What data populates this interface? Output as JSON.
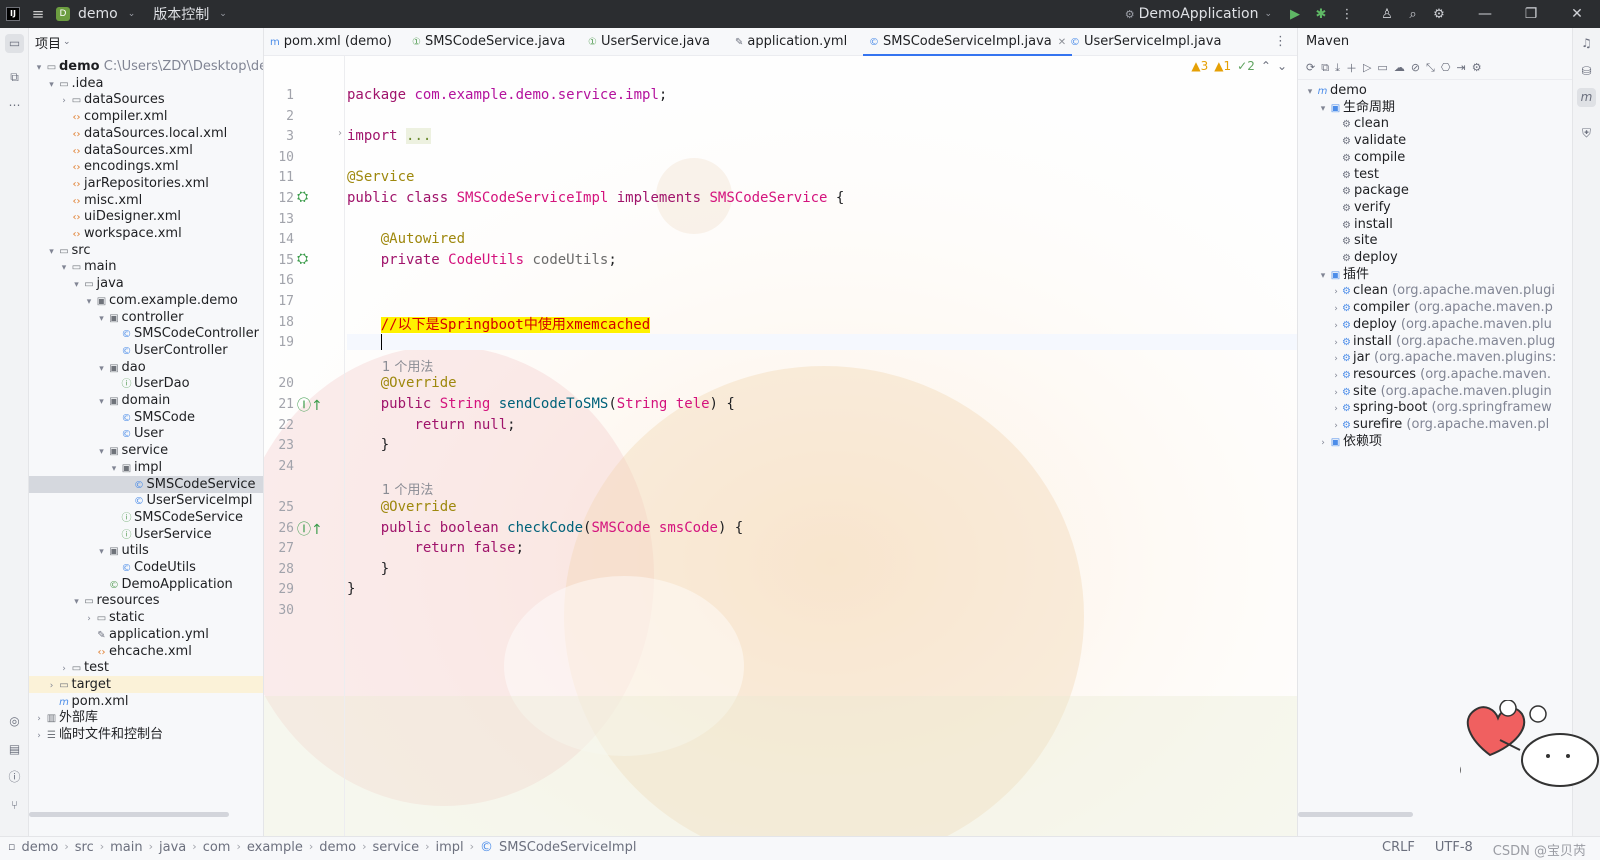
{
  "titlebar": {
    "project": "demo",
    "vcs": "版本控制",
    "run_config": "DemoApplication"
  },
  "project_panel": {
    "title": "项目",
    "tree": [
      {
        "label": "demo",
        "extra": "C:\\Users\\ZDY\\Desktop\\de",
        "depth": 0,
        "kind": "folder",
        "arrow": "▾",
        "bold": true
      },
      {
        "label": ".idea",
        "depth": 1,
        "kind": "folder",
        "arrow": "▾"
      },
      {
        "label": "dataSources",
        "depth": 2,
        "kind": "folder",
        "arrow": "›"
      },
      {
        "label": "compiler.xml",
        "depth": 2,
        "kind": "xml",
        "arrow": ""
      },
      {
        "label": "dataSources.local.xml",
        "depth": 2,
        "kind": "xml",
        "arrow": ""
      },
      {
        "label": "dataSources.xml",
        "depth": 2,
        "kind": "xml",
        "arrow": ""
      },
      {
        "label": "encodings.xml",
        "depth": 2,
        "kind": "xml",
        "arrow": ""
      },
      {
        "label": "jarRepositories.xml",
        "depth": 2,
        "kind": "xml",
        "arrow": ""
      },
      {
        "label": "misc.xml",
        "depth": 2,
        "kind": "xml",
        "arrow": ""
      },
      {
        "label": "uiDesigner.xml",
        "depth": 2,
        "kind": "xml",
        "arrow": ""
      },
      {
        "label": "workspace.xml",
        "depth": 2,
        "kind": "xml",
        "arrow": ""
      },
      {
        "label": "src",
        "depth": 1,
        "kind": "folder",
        "arrow": "▾"
      },
      {
        "label": "main",
        "depth": 2,
        "kind": "folder",
        "arrow": "▾"
      },
      {
        "label": "java",
        "depth": 3,
        "kind": "folder",
        "arrow": "▾"
      },
      {
        "label": "com.example.demo",
        "depth": 4,
        "kind": "pkg",
        "arrow": "▾"
      },
      {
        "label": "controller",
        "depth": 5,
        "kind": "pkg",
        "arrow": "▾"
      },
      {
        "label": "SMSCodeController",
        "depth": 6,
        "kind": "cls",
        "arrow": ""
      },
      {
        "label": "UserController",
        "depth": 6,
        "kind": "cls",
        "arrow": ""
      },
      {
        "label": "dao",
        "depth": 5,
        "kind": "pkg",
        "arrow": "▾"
      },
      {
        "label": "UserDao",
        "depth": 6,
        "kind": "intf",
        "arrow": ""
      },
      {
        "label": "domain",
        "depth": 5,
        "kind": "pkg",
        "arrow": "▾"
      },
      {
        "label": "SMSCode",
        "depth": 6,
        "kind": "cls",
        "arrow": ""
      },
      {
        "label": "User",
        "depth": 6,
        "kind": "cls",
        "arrow": ""
      },
      {
        "label": "service",
        "depth": 5,
        "kind": "pkg",
        "arrow": "▾"
      },
      {
        "label": "impl",
        "depth": 6,
        "kind": "pkg",
        "arrow": "▾"
      },
      {
        "label": "SMSCodeService",
        "depth": 7,
        "kind": "cls",
        "arrow": "",
        "selected": true
      },
      {
        "label": "UserServiceImpl",
        "depth": 7,
        "kind": "cls",
        "arrow": ""
      },
      {
        "label": "SMSCodeService",
        "depth": 6,
        "kind": "intf",
        "arrow": ""
      },
      {
        "label": "UserService",
        "depth": 6,
        "kind": "intf",
        "arrow": ""
      },
      {
        "label": "utils",
        "depth": 5,
        "kind": "pkg",
        "arrow": "▾"
      },
      {
        "label": "CodeUtils",
        "depth": 6,
        "kind": "cls",
        "arrow": ""
      },
      {
        "label": "DemoApplication",
        "depth": 5,
        "kind": "boot",
        "arrow": ""
      },
      {
        "label": "resources",
        "depth": 3,
        "kind": "folder",
        "arrow": "▾"
      },
      {
        "label": "static",
        "depth": 4,
        "kind": "folder",
        "arrow": "›"
      },
      {
        "label": "application.yml",
        "depth": 4,
        "kind": "yml",
        "arrow": ""
      },
      {
        "label": "ehcache.xml",
        "depth": 4,
        "kind": "xml",
        "arrow": ""
      },
      {
        "label": "test",
        "depth": 2,
        "kind": "folder",
        "arrow": "›"
      },
      {
        "label": "target",
        "depth": 1,
        "kind": "folder",
        "arrow": "›",
        "excluded": true
      },
      {
        "label": "pom.xml",
        "depth": 1,
        "kind": "mvn",
        "arrow": ""
      },
      {
        "label": "外部库",
        "depth": 0,
        "kind": "lib",
        "arrow": "›"
      },
      {
        "label": "临时文件和控制台",
        "depth": 0,
        "kind": "scratch",
        "arrow": "›"
      }
    ]
  },
  "tabs": [
    {
      "label": "pom.xml (demo)",
      "icon": "m",
      "kind": "mvn"
    },
    {
      "label": "SMSCodeService.java",
      "icon": "①",
      "kind": "intf"
    },
    {
      "label": "UserService.java",
      "icon": "①",
      "kind": "intf"
    },
    {
      "label": "application.yml",
      "icon": "✎",
      "kind": "yml"
    },
    {
      "label": "SMSCodeServiceImpl.java",
      "icon": "©",
      "kind": "cls",
      "active": true
    },
    {
      "label": "UserServiceImpl.java",
      "icon": "©",
      "kind": "cls"
    }
  ],
  "inspections": {
    "warnings": "3",
    "weak": "1",
    "ok": "2"
  },
  "code_lines": [
    {
      "no": "1",
      "html": "<span class='kw'>package</span> <span class='pkg'>com.example.demo.service.impl</span>;"
    },
    {
      "no": "2",
      "html": ""
    },
    {
      "no": "3",
      "html": "<span class='kw'>import</span> <span class='fold'>...</span>"
    },
    {
      "no": "10",
      "html": ""
    },
    {
      "no": "11",
      "html": "<span class='ann'>@Service</span>"
    },
    {
      "no": "12",
      "html": "<span class='kw'>public class</span> <span class='type'>SMSCodeServiceImpl</span> <span class='kw'>implements</span> <span class='type'>SMSCodeService</span> {"
    },
    {
      "no": "13",
      "html": ""
    },
    {
      "no": "14",
      "html": "    <span class='ann'>@Autowired</span>"
    },
    {
      "no": "15",
      "html": "    <span class='kw'>private</span> <span class='type'>CodeUtils</span> <span style='color:#6b6b6b'>codeUtils</span>;"
    },
    {
      "no": "16",
      "html": ""
    },
    {
      "no": "17",
      "html": ""
    },
    {
      "no": "18",
      "html": "    <span class='comment-hl'>//以下是Springboot中使用xmemcached</span>"
    },
    {
      "no": "19",
      "html": "    <span style='border-left:1px solid #000'>&#8203;</span>"
    },
    {
      "no": "20",
      "html": "    <span class='ann'>@Override</span>"
    },
    {
      "no": "21",
      "html": "    <span class='kw'>public</span> <span class='type'>String</span> <span class='mth'>sendCodeToSMS</span>(<span class='type'>String</span> <span class='type'>tele</span>) {"
    },
    {
      "no": "22",
      "html": "        <span class='kw'>return null</span>;"
    },
    {
      "no": "23",
      "html": "    }"
    },
    {
      "no": "24",
      "html": ""
    },
    {
      "no": "25",
      "html": "    <span class='ann'>@Override</span>"
    },
    {
      "no": "26",
      "html": "    <span class='kw'>public boolean</span> <span class='mth'>checkCode</span>(<span class='type'>SMSCode</span> <span class='type'>smsCode</span>) {"
    },
    {
      "no": "27",
      "html": "        <span class='kw'>return false</span>;"
    },
    {
      "no": "28",
      "html": "    }"
    },
    {
      "no": "29",
      "html": "}"
    },
    {
      "no": "30",
      "html": ""
    }
  ],
  "usage_hint": "1 个用法",
  "maven": {
    "title": "Maven",
    "tree": [
      {
        "label": "demo",
        "depth": 0,
        "kind": "mvn",
        "arrow": "▾"
      },
      {
        "label": "生命周期",
        "depth": 1,
        "kind": "folder",
        "arrow": "▾"
      },
      {
        "label": "clean",
        "depth": 2,
        "kind": "gear"
      },
      {
        "label": "validate",
        "depth": 2,
        "kind": "gear"
      },
      {
        "label": "compile",
        "depth": 2,
        "kind": "gear"
      },
      {
        "label": "test",
        "depth": 2,
        "kind": "gear"
      },
      {
        "label": "package",
        "depth": 2,
        "kind": "gear"
      },
      {
        "label": "verify",
        "depth": 2,
        "kind": "gear"
      },
      {
        "label": "install",
        "depth": 2,
        "kind": "gear"
      },
      {
        "label": "site",
        "depth": 2,
        "kind": "gear"
      },
      {
        "label": "deploy",
        "depth": 2,
        "kind": "gear"
      },
      {
        "label": "插件",
        "depth": 1,
        "kind": "folder",
        "arrow": "▾"
      },
      {
        "label": "clean",
        "extra": "(org.apache.maven.plugi",
        "depth": 2,
        "kind": "plugin",
        "arrow": "›"
      },
      {
        "label": "compiler",
        "extra": "(org.apache.maven.p",
        "depth": 2,
        "kind": "plugin",
        "arrow": "›"
      },
      {
        "label": "deploy",
        "extra": "(org.apache.maven.plu",
        "depth": 2,
        "kind": "plugin",
        "arrow": "›"
      },
      {
        "label": "install",
        "extra": "(org.apache.maven.plug",
        "depth": 2,
        "kind": "plugin",
        "arrow": "›"
      },
      {
        "label": "jar",
        "extra": "(org.apache.maven.plugins:",
        "depth": 2,
        "kind": "plugin",
        "arrow": "›"
      },
      {
        "label": "resources",
        "extra": "(org.apache.maven.",
        "depth": 2,
        "kind": "plugin",
        "arrow": "›"
      },
      {
        "label": "site",
        "extra": "(org.apache.maven.plugin",
        "depth": 2,
        "kind": "plugin",
        "arrow": "›"
      },
      {
        "label": "spring-boot",
        "extra": "(org.springframew",
        "depth": 2,
        "kind": "plugin",
        "arrow": "›"
      },
      {
        "label": "surefire",
        "extra": "(org.apache.maven.pl",
        "depth": 2,
        "kind": "plugin",
        "arrow": "›"
      },
      {
        "label": "依赖项",
        "depth": 1,
        "kind": "folder",
        "arrow": "›"
      }
    ]
  },
  "breadcrumbs": [
    "demo",
    "src",
    "main",
    "java",
    "com",
    "example",
    "demo",
    "service",
    "impl",
    "SMSCodeServiceImpl"
  ],
  "status": {
    "line_sep": "CRLF",
    "encoding": "UTF-8",
    "watermark": "CSDN @宝贝芮"
  }
}
